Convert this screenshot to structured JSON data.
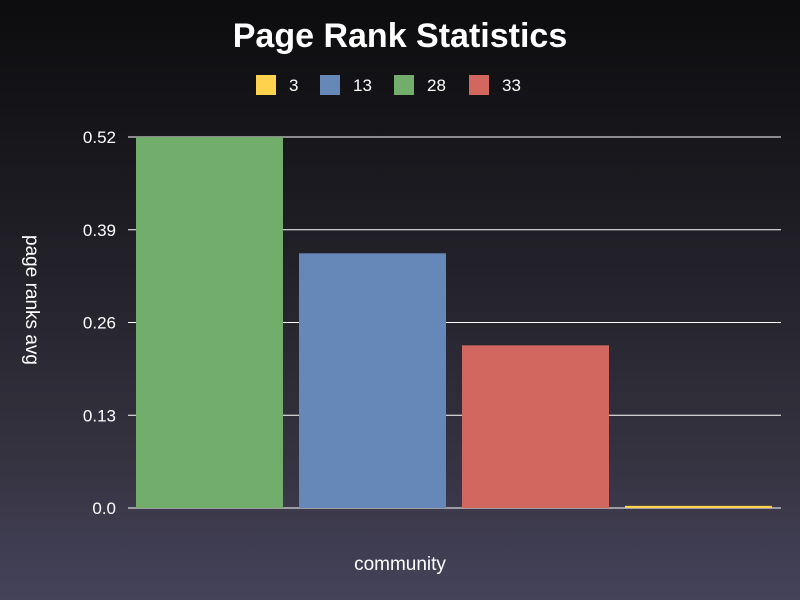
{
  "chart_data": {
    "type": "bar",
    "title": "Page Rank Statistics",
    "xlabel": "community",
    "ylabel": "page ranks avg",
    "ylim": [
      0,
      0.52
    ],
    "yticks": [
      "0.0",
      "0.13",
      "0.26",
      "0.39",
      "0.52"
    ],
    "ytick_values": [
      0,
      0.13,
      0.26,
      0.39,
      0.52
    ],
    "grid": true,
    "legend_position": "top",
    "legend": [
      {
        "label": "3",
        "color": "#ffd24d"
      },
      {
        "label": "13",
        "color": "#6688b8"
      },
      {
        "label": "28",
        "color": "#72ad6c"
      },
      {
        "label": "33",
        "color": "#d1675e"
      }
    ],
    "bars": [
      {
        "series": "28",
        "value": 0.52,
        "color": "#72ad6c"
      },
      {
        "series": "13",
        "value": 0.357,
        "color": "#6688b8"
      },
      {
        "series": "33",
        "value": 0.228,
        "color": "#d1675e"
      },
      {
        "series": "3",
        "value": 0.003,
        "color": "#ffd24d"
      }
    ]
  }
}
